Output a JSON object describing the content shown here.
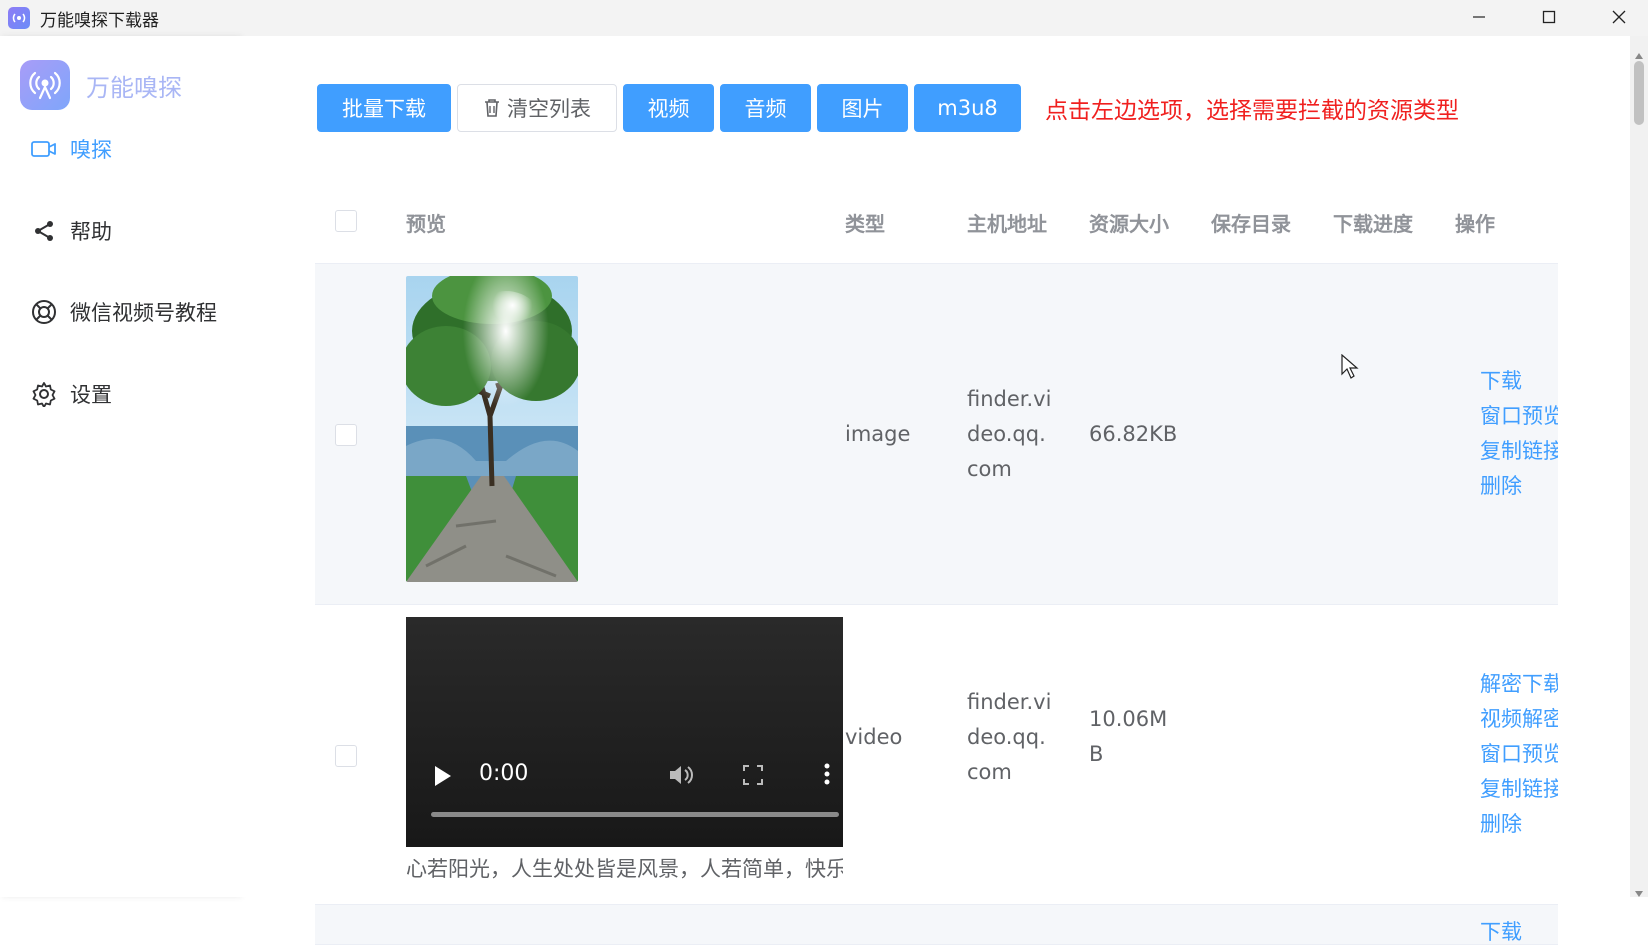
{
  "window": {
    "title": "万能嗅探下载器"
  },
  "sidebar": {
    "logo_text": "万能嗅探",
    "items": [
      {
        "label": "嗅探",
        "icon": "video-icon",
        "active": true
      },
      {
        "label": "帮助",
        "icon": "share-icon",
        "active": false
      },
      {
        "label": "微信视频号教程",
        "icon": "lifebuoy-icon",
        "active": false
      },
      {
        "label": "设置",
        "icon": "gear-icon",
        "active": false
      }
    ]
  },
  "toolbar": {
    "batch_download": "批量下载",
    "clear_list": "清空列表",
    "filter_video": "视频",
    "filter_audio": "音频",
    "filter_image": "图片",
    "filter_m3u8": "m3u8",
    "hint": "点击左边选项，选择需要拦截的资源类型"
  },
  "table": {
    "headers": {
      "preview": "预览",
      "type": "类型",
      "host": "主机地址",
      "size": "资源大小",
      "save_dir": "保存目录",
      "progress": "下载进度",
      "actions": "操作"
    },
    "rows": [
      {
        "type": "image",
        "host_lines": [
          "finder.vi",
          "deo.qq.",
          "com"
        ],
        "size_lines": [
          "66.82KB"
        ],
        "actions": [
          "下载",
          "窗口预览",
          "复制链接",
          "删除"
        ]
      },
      {
        "type": "video",
        "host_lines": [
          "finder.vi",
          "deo.qq.",
          "com"
        ],
        "size_lines": [
          "10.06M",
          "B"
        ],
        "video_time": "0:00",
        "caption": "心若阳光，人生处处皆是风景，人若简单，快乐",
        "actions": [
          "解密下载",
          "视频解密",
          "窗口预览",
          "复制链接",
          "删除"
        ]
      }
    ],
    "next_row_first_action": "下载"
  },
  "colors": {
    "primary": "#409eff",
    "hint": "#f0201f",
    "row_bg": "#f5f7fa"
  }
}
